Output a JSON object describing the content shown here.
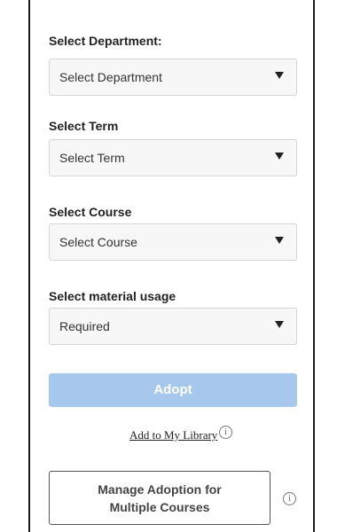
{
  "form": {
    "department": {
      "label": "Select Department:",
      "value": "Select Department"
    },
    "term": {
      "label": "Select Term",
      "value": "Select Term"
    },
    "course": {
      "label": "Select Course",
      "value": "Select Course"
    },
    "usage": {
      "label": "Select material usage",
      "value": "Required"
    }
  },
  "actions": {
    "adopt_label": "Adopt",
    "library_link": "Add to My Library",
    "manage_line1": "Manage Adoption for",
    "manage_line2": "Multiple Courses",
    "info_glyph": "i"
  },
  "colors": {
    "adopt_disabled_bg": "#a7c8ed",
    "select_bg": "#f7f7f7"
  },
  "icons": {
    "dropdown": "caret-down-icon",
    "info": "info-icon"
  }
}
